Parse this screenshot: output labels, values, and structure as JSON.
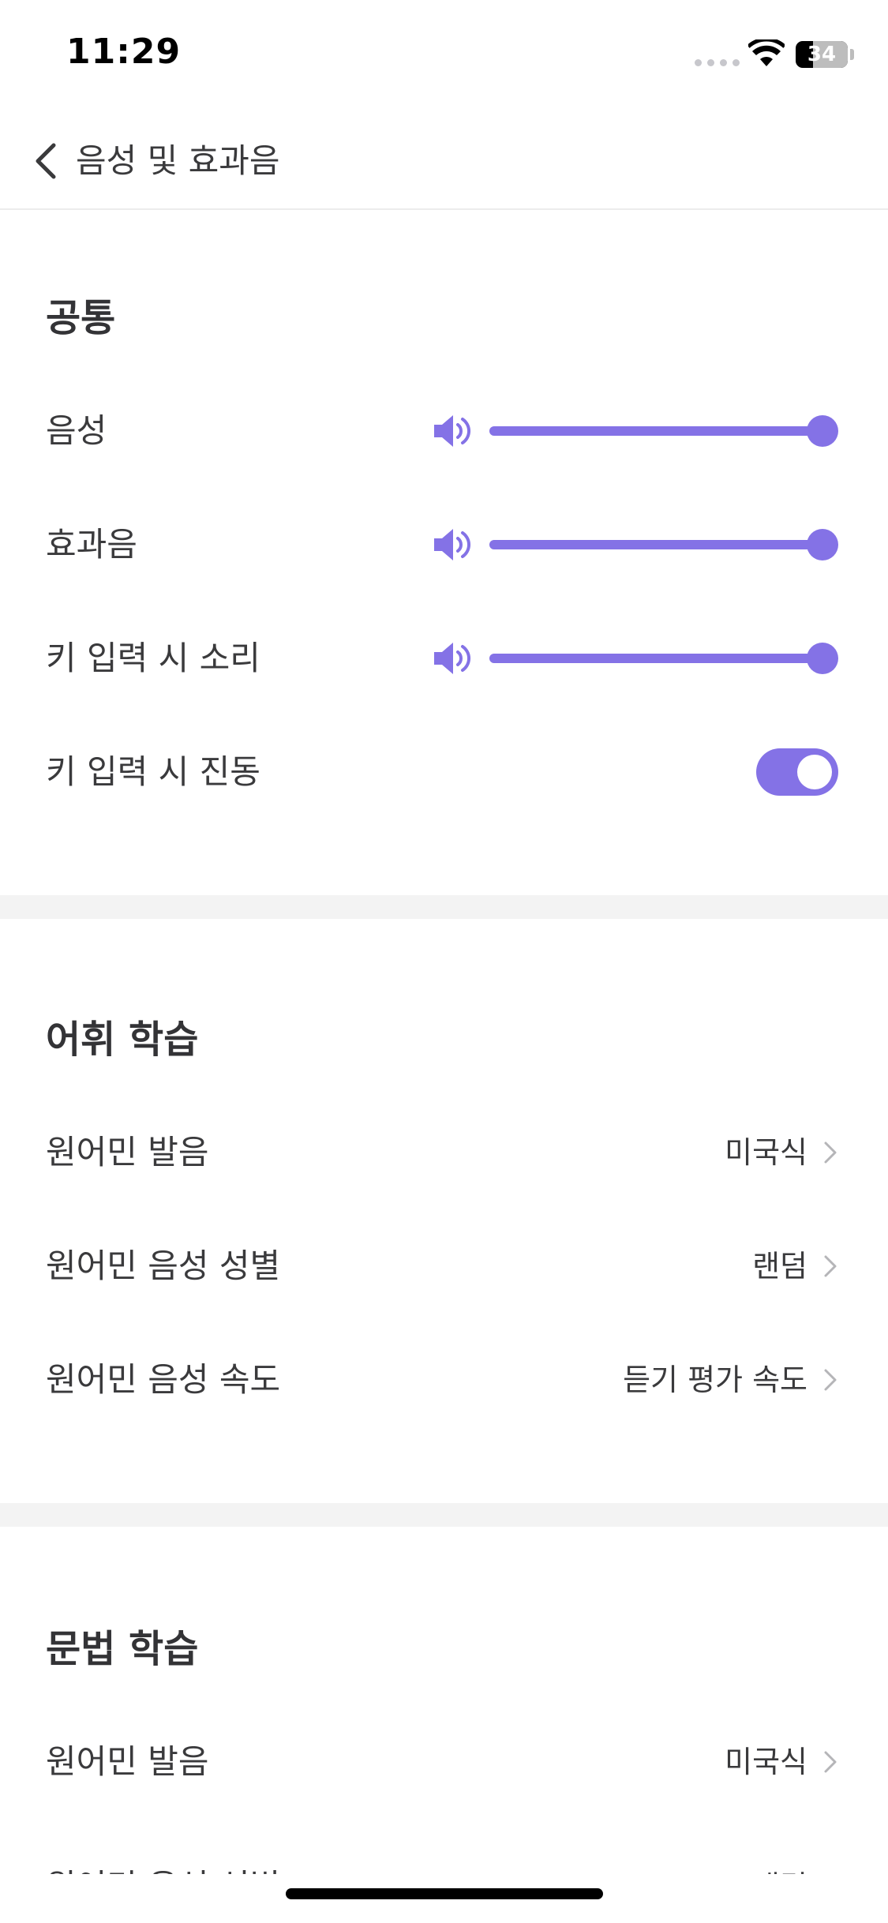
{
  "status_bar": {
    "time": "11:29",
    "battery": "34",
    "battery_level": 0.34
  },
  "nav": {
    "title": "음성 및 효과음"
  },
  "common": {
    "title": "공통",
    "voice_label": "음성",
    "voice_level": 1.0,
    "effect_label": "효과음",
    "effect_level": 1.0,
    "key_sound_label": "키 입력 시 소리",
    "key_sound_level": 1.0,
    "key_vibration_label": "키 입력 시 진동",
    "key_vibration_on": true
  },
  "vocab": {
    "title": "어휘 학습",
    "pronunciation_label": "원어민 발음",
    "pronunciation_value": "미국식",
    "gender_label": "원어민 음성 성별",
    "gender_value": "랜덤",
    "speed_label": "원어민 음성 속도",
    "speed_value": "듣기 평가 속도"
  },
  "grammar": {
    "title": "문법 학습",
    "pronunciation_label": "원어민 발음",
    "pronunciation_value": "미국식",
    "gender_label": "원어민 음성 성별",
    "gender_value": "랜덤"
  },
  "colors": {
    "accent": "#8472e6",
    "divider": "#f3f3f3"
  }
}
